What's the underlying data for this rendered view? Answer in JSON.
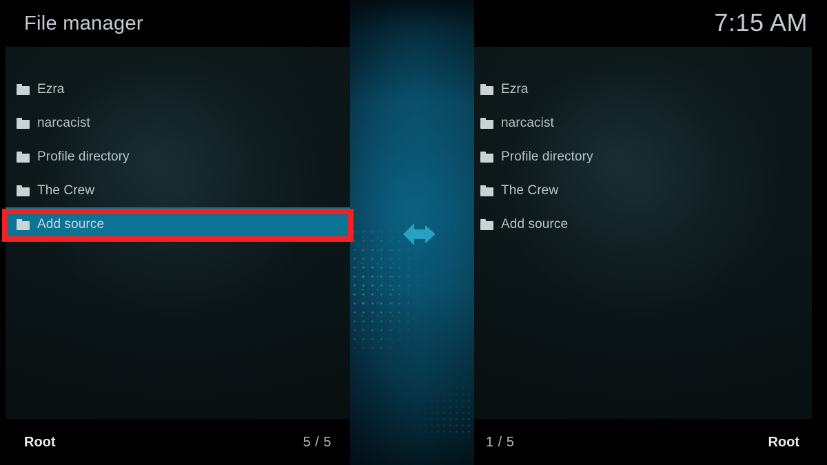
{
  "header": {
    "title": "File manager",
    "clock": "7:15 AM"
  },
  "icons": {
    "folder": "folder-icon",
    "transfer": "left-right-arrows-icon"
  },
  "colors": {
    "selection": "#0b7495",
    "annotation": "#ef2323",
    "center_panel": "#0a5572",
    "panel_background": "#0b1416",
    "text": "#b9c4c7"
  },
  "left_panel": {
    "items": [
      {
        "label": "Ezra",
        "selected": false
      },
      {
        "label": "narcacist",
        "selected": false
      },
      {
        "label": "Profile directory",
        "selected": false
      },
      {
        "label": "The Crew",
        "selected": false
      },
      {
        "label": "Add source",
        "selected": true
      }
    ],
    "footer": {
      "path": "Root",
      "count": "5 / 5"
    }
  },
  "right_panel": {
    "items": [
      {
        "label": "Ezra",
        "selected": false
      },
      {
        "label": "narcacist",
        "selected": false
      },
      {
        "label": "Profile directory",
        "selected": false
      },
      {
        "label": "The Crew",
        "selected": false
      },
      {
        "label": "Add source",
        "selected": false
      }
    ],
    "footer": {
      "path": "Root",
      "count": "1 / 5"
    }
  }
}
